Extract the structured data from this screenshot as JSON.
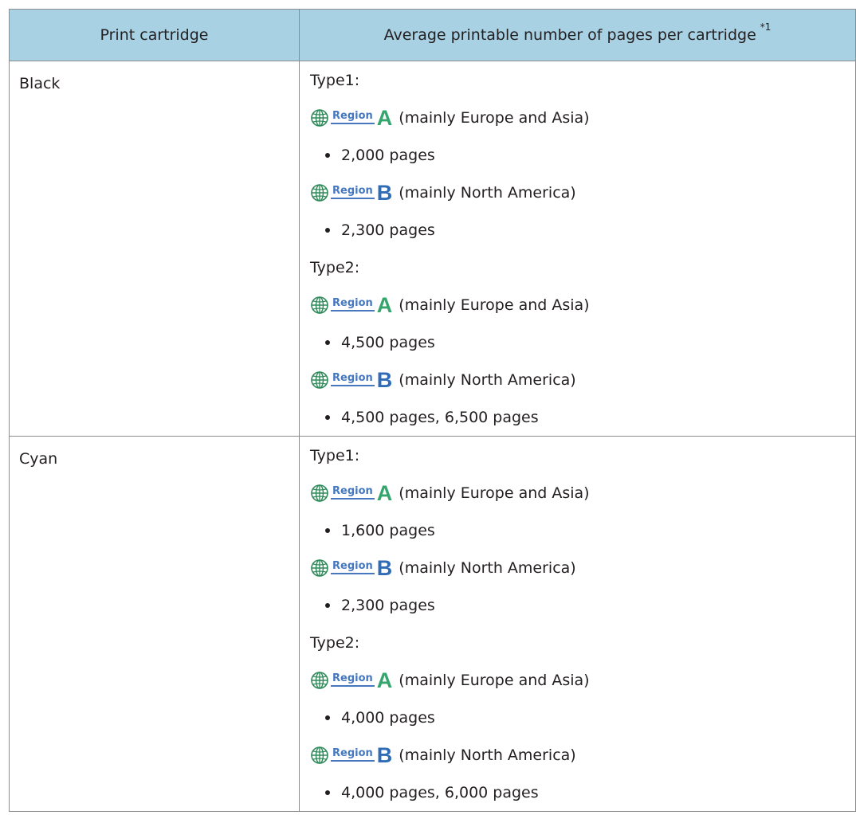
{
  "table": {
    "headers": {
      "col1": "Print cartridge",
      "col2": "Average printable number of pages per cartridge",
      "col2_footnote": "*1"
    },
    "rows": [
      {
        "cartridge": "Black",
        "types": [
          {
            "label": "Type1:",
            "regions": [
              {
                "badge": "Region",
                "letter": "A",
                "note": "(mainly Europe and Asia)",
                "pages": "2,000 pages"
              },
              {
                "badge": "Region",
                "letter": "B",
                "note": "(mainly North America)",
                "pages": "2,300 pages"
              }
            ]
          },
          {
            "label": "Type2:",
            "regions": [
              {
                "badge": "Region",
                "letter": "A",
                "note": "(mainly Europe and Asia)",
                "pages": "4,500 pages"
              },
              {
                "badge": "Region",
                "letter": "B",
                "note": "(mainly North America)",
                "pages": "4,500 pages, 6,500 pages"
              }
            ]
          }
        ]
      },
      {
        "cartridge": "Cyan",
        "types": [
          {
            "label": "Type1:",
            "regions": [
              {
                "badge": "Region",
                "letter": "A",
                "note": "(mainly Europe and Asia)",
                "pages": "1,600 pages"
              },
              {
                "badge": "Region",
                "letter": "B",
                "note": "(mainly North America)",
                "pages": "2,300 pages"
              }
            ]
          },
          {
            "label": "Type2:",
            "regions": [
              {
                "badge": "Region",
                "letter": "A",
                "note": "(mainly Europe and Asia)",
                "pages": "4,000 pages"
              },
              {
                "badge": "Region",
                "letter": "B",
                "note": "(mainly North America)",
                "pages": "4,000 pages, 6,000 pages"
              }
            ]
          }
        ]
      }
    ]
  },
  "colors": {
    "header_bg": "#a9d1e4",
    "region_a_letter": "#34a66d",
    "region_b_letter": "#2f6cb5",
    "region_badge": "#4678c0",
    "border": "#8c8c8c"
  },
  "icons": {
    "region_mark": "globe-icon"
  }
}
